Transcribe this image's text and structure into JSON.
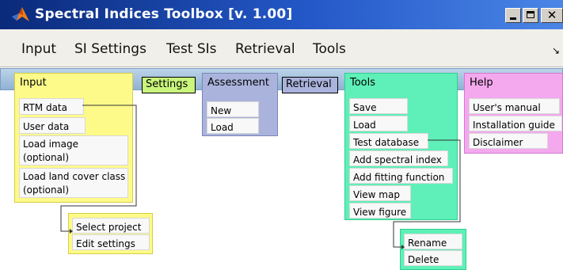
{
  "window": {
    "title": "Spectral Indices Toolbox [v. 1.00]",
    "icons": {
      "app": "matlab-icon",
      "minimize": "minimize-icon",
      "maximize": "maximize-icon",
      "close": "close-icon"
    }
  },
  "menubar": {
    "items": [
      "Input",
      "SI Settings",
      "Test SIs",
      "Retrieval",
      "Tools"
    ],
    "dock_icon": "dock-arrow-icon",
    "dock_glyph": "↘"
  },
  "diagram": {
    "input": {
      "header": "Input",
      "items": [
        "RTM data",
        "User data",
        "Load image\n (optional)",
        "Load land cover class\n (optional)"
      ]
    },
    "settings": {
      "header": "Settings",
      "items": [
        "Select project",
        "Edit settings"
      ]
    },
    "assessment": {
      "header": "Assessment",
      "items": [
        "New",
        "Load"
      ]
    },
    "retrieval": {
      "header": "Retrieval"
    },
    "tools": {
      "header": "Tools",
      "items": [
        "Save",
        "Load",
        "Test database",
        "Add spectral index",
        "Add fitting function",
        "View map",
        "View figure"
      ],
      "sub_items": [
        "Rename",
        "Delete"
      ]
    },
    "help": {
      "header": "Help",
      "items": [
        "User's manual",
        "Installation guide",
        "Disclaimer"
      ]
    }
  },
  "colors": {
    "title_gradient_start": "#0a2a7a",
    "title_gradient_end": "#4b86e6",
    "strip": "#a6c2e0",
    "input_panel": "#fdfa8a",
    "settings_label": "#c9f57c",
    "assessment_panel": "#aab3dc",
    "retrieval_label": "#aab3dc",
    "tools_panel": "#5ef0b8",
    "help_panel": "#f4a8ee"
  }
}
